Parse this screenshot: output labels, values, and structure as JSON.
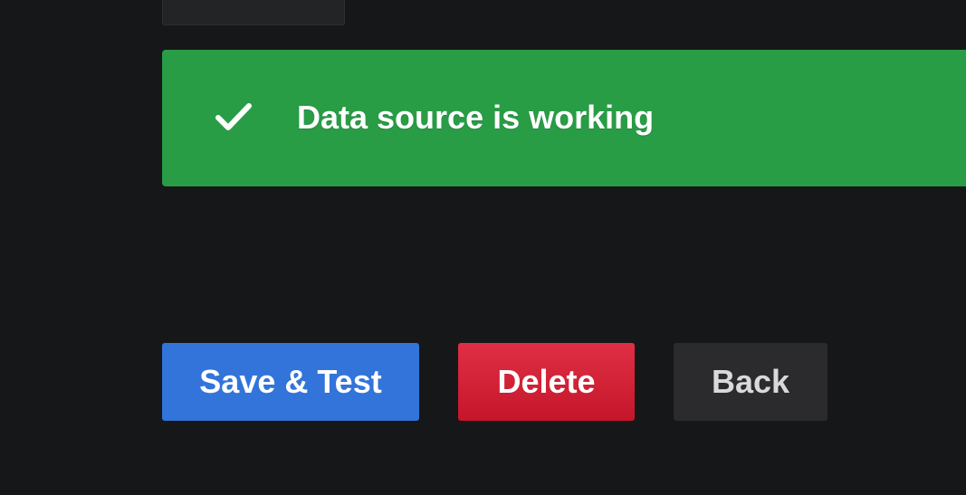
{
  "alert": {
    "icon": "check-icon",
    "message": "Data source is working",
    "color": "#299c46"
  },
  "actions": {
    "save_test_label": "Save & Test",
    "delete_label": "Delete",
    "back_label": "Back"
  },
  "colors": {
    "background": "#161719",
    "primary": "#3274d9",
    "danger": "#e02f44",
    "secondary": "#2b2b2e"
  }
}
